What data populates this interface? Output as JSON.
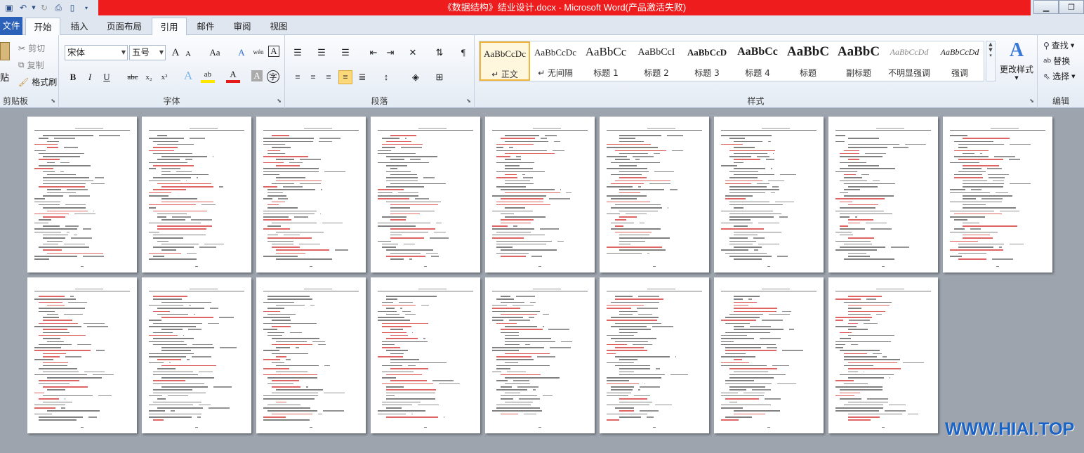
{
  "window": {
    "title": "《数据结构》结业设计.docx - Microsoft Word(产品激活失败)",
    "minimize": "▁",
    "restore": "❐"
  },
  "tabs": [
    "文件",
    "开始",
    "插入",
    "页面布局",
    "引用",
    "邮件",
    "审阅",
    "视图"
  ],
  "clipboard": {
    "paste": "贴",
    "cut": "剪切",
    "copy": "复制",
    "format_painter": "格式刷",
    "label": "剪贴板"
  },
  "font": {
    "name": "宋体",
    "size": "五号",
    "grow": "A",
    "shrink": "A",
    "case": "Aa",
    "clear": "A",
    "phonetic": "wén",
    "border_char": "A",
    "bold": "B",
    "italic": "I",
    "underline": "U",
    "strike": "abc",
    "subscript": "x₂",
    "superscript": "x²",
    "effects": "A",
    "highlight": "ab",
    "color": "A",
    "shading": "A",
    "enclose": "字",
    "label": "字体"
  },
  "paragraph": {
    "label": "段落"
  },
  "styles": {
    "items": [
      {
        "sample": "AaBbCcDc",
        "name": "↵ 正文"
      },
      {
        "sample": "AaBbCcDc",
        "name": "↵ 无间隔"
      },
      {
        "sample": "AaBbCc",
        "name": "标题 1"
      },
      {
        "sample": "AaBbCcI",
        "name": "标题 2"
      },
      {
        "sample": "AaBbCcD",
        "name": "标题 3"
      },
      {
        "sample": "AaBbCc",
        "name": "标题 4"
      },
      {
        "sample": "AaBbC",
        "name": "标题"
      },
      {
        "sample": "AaBbC",
        "name": "副标题"
      },
      {
        "sample": "AaBbCcDd",
        "name": "不明显强调"
      },
      {
        "sample": "AaBbCcDd",
        "name": "强调"
      }
    ],
    "change_styles": "更改样式",
    "label": "样式"
  },
  "editing": {
    "find": "查找",
    "replace": "替换",
    "select": "选择",
    "label": "编辑"
  },
  "watermark": "WWW.HIAI.TOP"
}
